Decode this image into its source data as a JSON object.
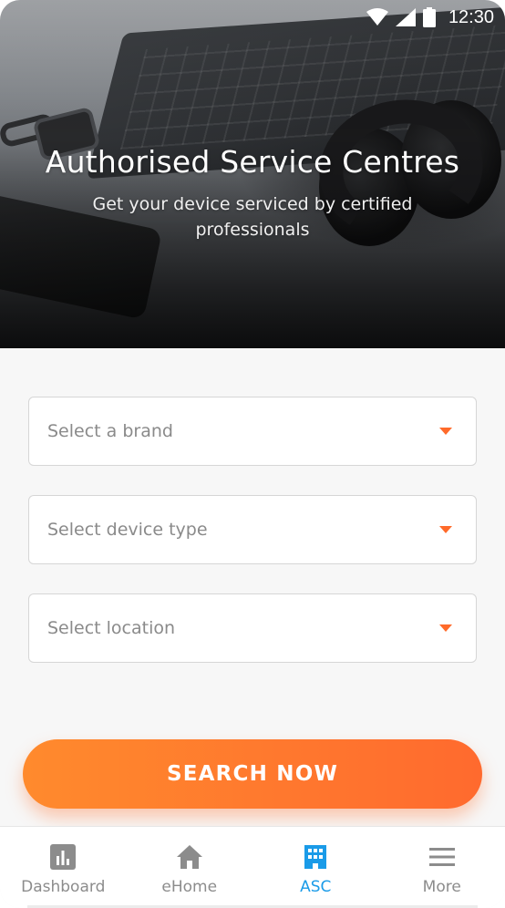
{
  "status_bar": {
    "time": "12:30"
  },
  "hero": {
    "title": "Authorised Service Centres",
    "subtitle": "Get your device serviced by certified professionals"
  },
  "form": {
    "brand_select": "Select a brand",
    "device_select": "Select device type",
    "location_select": "Select location",
    "search_label": "SEARCH NOW"
  },
  "nav": {
    "items": [
      {
        "label": "Dashboard",
        "icon": "chart-icon",
        "active": false
      },
      {
        "label": "eHome",
        "icon": "home-icon",
        "active": false
      },
      {
        "label": "ASC",
        "icon": "building-icon",
        "active": true
      },
      {
        "label": "More",
        "icon": "menu-icon",
        "active": false
      }
    ]
  },
  "colors": {
    "accent": "#ff6a2a",
    "active_nav": "#1a9be8",
    "inactive_nav": "#8c8c8c"
  }
}
